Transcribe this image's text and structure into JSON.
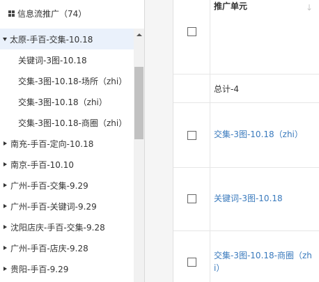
{
  "tree": {
    "header": "信息流推广（74）",
    "items": [
      {
        "label": "太原-手百-交集-10.18",
        "level": 0,
        "expanded": true,
        "selected": true
      },
      {
        "label": "关键词-3图-10.18",
        "level": 1
      },
      {
        "label": "交集-3图-10.18-场所（zhi）",
        "level": 1
      },
      {
        "label": "交集-3图-10.18（zhi）",
        "level": 1
      },
      {
        "label": "交集-3图-10.18-商圈（zhi）",
        "level": 1
      },
      {
        "label": "南充-手百-定向-10.18",
        "level": 0
      },
      {
        "label": "南京-手百-10.10",
        "level": 0
      },
      {
        "label": "广州-手百-交集-9.29",
        "level": 0
      },
      {
        "label": "广州-手百-关键词-9.29",
        "level": 0
      },
      {
        "label": "沈阳店庆-手百-交集-9.28",
        "level": 0
      },
      {
        "label": "广州-手百-店庆-9.28",
        "level": 0
      },
      {
        "label": "贵阳-手百-9.29",
        "level": 0
      }
    ]
  },
  "table": {
    "header": "推广单元",
    "total": "总计-4",
    "rows": [
      {
        "label": "交集-3图-10.18（zhi）"
      },
      {
        "label": "关键词-3图-10.18"
      },
      {
        "label_line1": "交集-3图-10.18-商圈（zh",
        "label_line2": "i）"
      }
    ]
  }
}
